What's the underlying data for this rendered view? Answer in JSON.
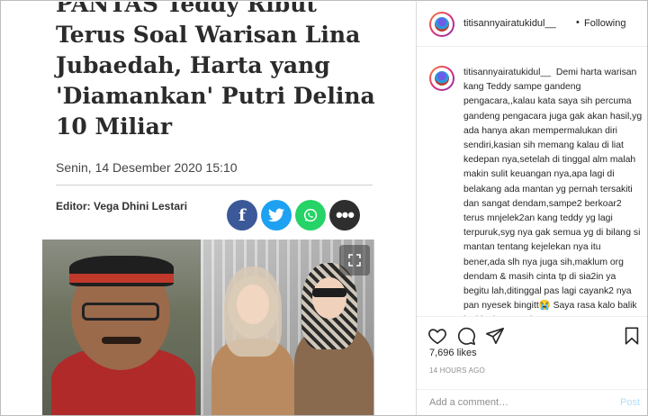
{
  "article": {
    "headline_lines": [
      "PANTAS Teddy Ribut",
      "Terus Soal Warisan Lina",
      "Jubaedah, Harta yang",
      "'Diamankan' Putri Delina",
      "10 Miliar"
    ],
    "date": "Senin, 14 Desember 2020 15:10",
    "editor": "Editor: Vega Dhini Lestari",
    "share_buttons": [
      {
        "label": "f",
        "icon": "facebook-icon",
        "color": "#3b5998"
      },
      {
        "label": "twitter",
        "icon": "twitter-icon",
        "color": "#1da1f2"
      },
      {
        "label": "whatsapp",
        "icon": "whatsapp-icon",
        "color": "#25d366"
      },
      {
        "label": "•••",
        "icon": "more-icon",
        "color": "#2e2e2e"
      }
    ]
  },
  "instagram": {
    "username": "titisannyairatukidul__",
    "separator": "•",
    "follow_status": "Following",
    "caption_username": "titisannyairatukidul__",
    "caption_text": "Demi harta warisan kang Teddy sampe gandeng pengacara,,kalau kata saya sih percuma gandeng pengacara juga gak akan hasil,yg ada hanya akan mempermalukan diri sendiri,kasian sih memang kalau di liat kedepan nya,setelah di tinggal alm malah makin sulit keuangan nya,apa lagi di belakang ada mantan yg pernah tersakiti dan sangat dendam,sampe2 berkoar2 terus mnjelek2an kang teddy yg lagi terpuruk,syg nya gak semua yg di bilang si mantan tentang kejelekan nya itu bener,ada slh nya juga sih,maklum org dendam & masih cinta tp di sia2in ya begitu lah,ditinggal pas lagi cayank2 nya pan nyesek bingitt😭 Saya rasa kalo balik lagi ke luar negri",
    "likes": "7,696 likes",
    "time_ago": "14 HOURS AGO",
    "comment_placeholder": "Add a comment…",
    "post_label": "Post",
    "icons": [
      "heart-icon",
      "comment-icon",
      "share-icon",
      "bookmark-icon"
    ]
  }
}
